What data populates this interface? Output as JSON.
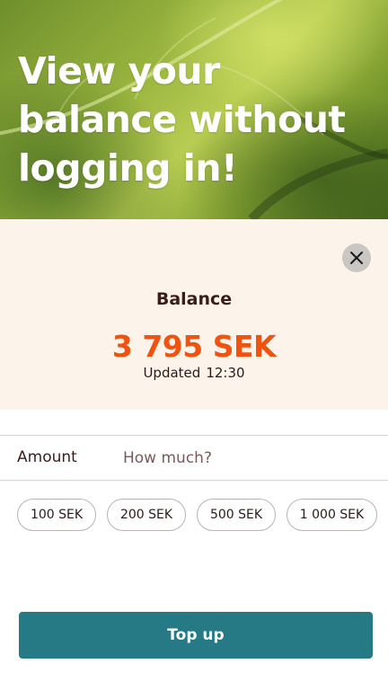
{
  "hero": {
    "title": "View your balance without logging in!"
  },
  "balance": {
    "label": "Balance",
    "amount": "3 795 SEK",
    "updated_label": "Updated",
    "updated_time": "12:30"
  },
  "close": {
    "icon": "close-icon"
  },
  "amount": {
    "label": "Amount",
    "placeholder": "How much?",
    "value": ""
  },
  "quick_amounts": [
    "100 SEK",
    "200 SEK",
    "500 SEK",
    "1 000 SEK"
  ],
  "actions": {
    "top_up_label": "Top up"
  },
  "colors": {
    "accent": "#f0520f",
    "button": "#257a86",
    "panel": "#fcf3eb",
    "text_dark": "#3a1d1a"
  }
}
